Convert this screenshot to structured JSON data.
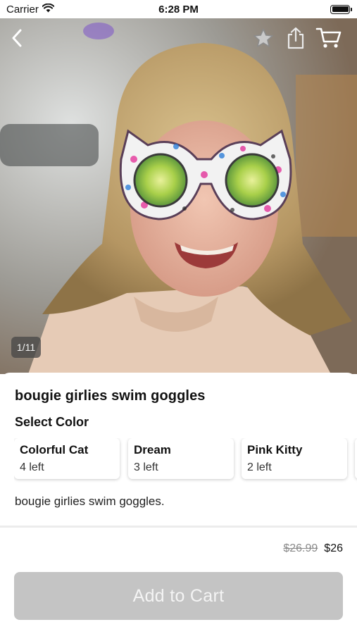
{
  "status_bar": {
    "carrier": "Carrier",
    "time": "6:28 PM"
  },
  "hero": {
    "page_counter": "1/11",
    "icons": [
      "back-chevron-icon",
      "star-icon",
      "share-icon",
      "cart-icon"
    ]
  },
  "product": {
    "title": "bougie girlies swim goggles",
    "select_color_label": "Select Color",
    "variants": [
      {
        "name": "Colorful Cat",
        "stock": "4 left"
      },
      {
        "name": "Dream",
        "stock": "3 left"
      },
      {
        "name": "Pink Kitty",
        "stock": "2 left"
      }
    ],
    "description": "bougie girlies swim goggles."
  },
  "purchase": {
    "original_price": "$26.99",
    "price": "$26",
    "add_to_cart_label": "Add to Cart"
  },
  "colors": {
    "button_disabled": "#c4c4c4",
    "strike_price": "#8a8a8a"
  }
}
